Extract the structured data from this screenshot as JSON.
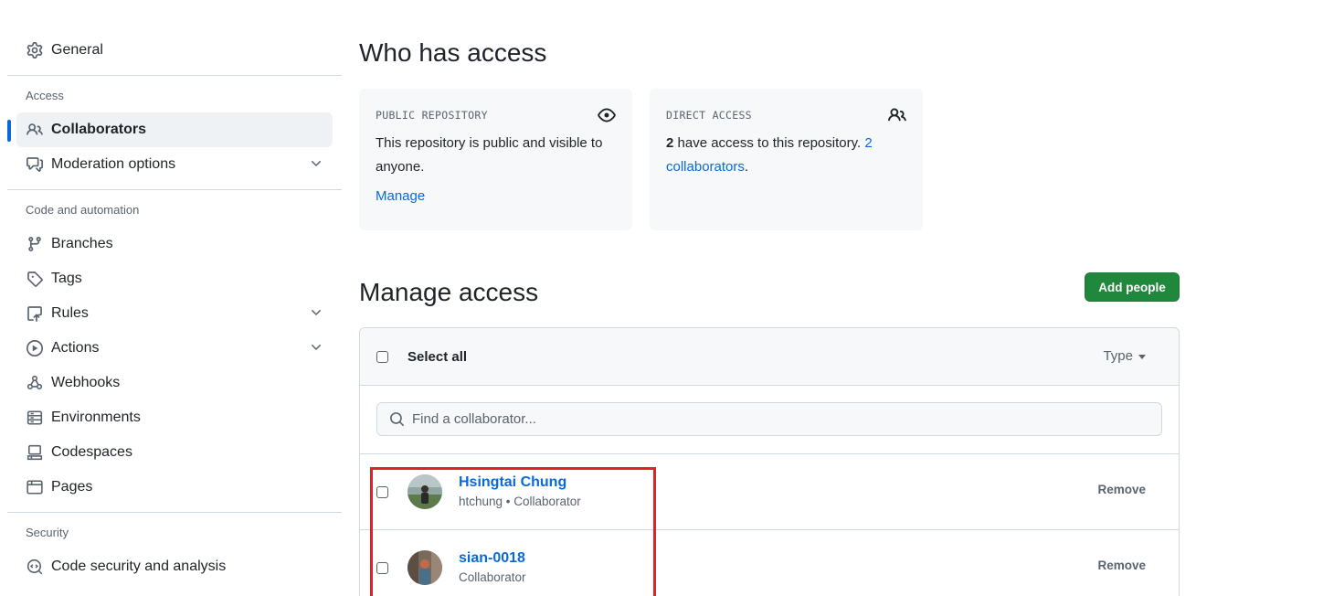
{
  "sidebar": {
    "general": {
      "label": "General",
      "icon": "gear-icon"
    },
    "access_heading": "Access",
    "access_items": [
      {
        "label": "Collaborators",
        "icon": "people-icon",
        "active": true,
        "expandable": false
      },
      {
        "label": "Moderation options",
        "icon": "comment-discussion-icon",
        "active": false,
        "expandable": true
      }
    ],
    "code_heading": "Code and automation",
    "code_items": [
      {
        "label": "Branches",
        "icon": "git-branch-icon",
        "expandable": false
      },
      {
        "label": "Tags",
        "icon": "tag-icon",
        "expandable": false
      },
      {
        "label": "Rules",
        "icon": "repo-push-icon",
        "expandable": true
      },
      {
        "label": "Actions",
        "icon": "play-icon",
        "expandable": true
      },
      {
        "label": "Webhooks",
        "icon": "webhook-icon",
        "expandable": false
      },
      {
        "label": "Environments",
        "icon": "server-icon",
        "expandable": false
      },
      {
        "label": "Codespaces",
        "icon": "codespaces-icon",
        "expandable": false
      },
      {
        "label": "Pages",
        "icon": "browser-icon",
        "expandable": false
      }
    ],
    "security_heading": "Security",
    "security_items": [
      {
        "label": "Code security and analysis",
        "icon": "codescan-icon"
      }
    ]
  },
  "who_has_access": {
    "title": "Who has access",
    "public_card": {
      "kicker": "PUBLIC REPOSITORY",
      "text": "This repository is public and visible to anyone.",
      "manage_link": "Manage"
    },
    "direct_card": {
      "kicker": "DIRECT ACCESS",
      "count": "2",
      "text": " have access to this repository. ",
      "link": "2 collaborators",
      "trail": "."
    }
  },
  "manage_access": {
    "title": "Manage access",
    "add_button": "Add people",
    "select_all": "Select all",
    "type_filter": "Type",
    "search_placeholder": "Find a collaborator...",
    "collaborators": [
      {
        "name": "Hsingtai Chung",
        "meta": "htchung • Collaborator",
        "remove": "Remove"
      },
      {
        "name": "sian-0018",
        "meta": "Collaborator",
        "remove": "Remove"
      }
    ]
  },
  "colors": {
    "accent": "#0969da",
    "primary_button": "#1f883d",
    "highlight_box": "#e0202a"
  }
}
